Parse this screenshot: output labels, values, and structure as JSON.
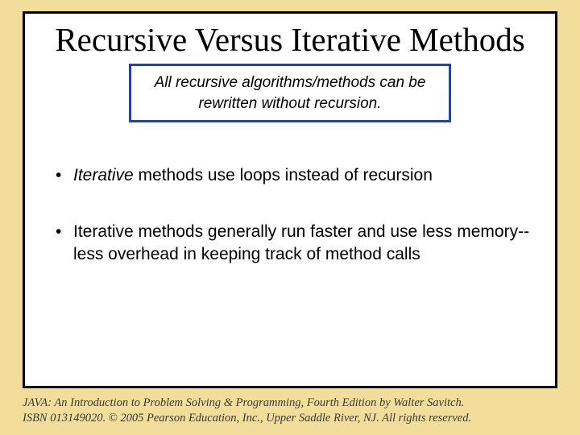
{
  "slide": {
    "title": "Recursive Versus Iterative Methods",
    "callout": "All recursive algorithms/methods can be rewritten without recursion.",
    "bullets": [
      {
        "italic": "Iterative",
        "rest": " methods use loops instead of recursion"
      },
      {
        "italic": "",
        "rest": "Iterative methods generally run faster and use less memory--less overhead in keeping track of method calls"
      }
    ]
  },
  "footer": {
    "line1": "JAVA: An Introduction to Problem Solving & Programming, Fourth Edition by Walter Savitch.",
    "line2": "ISBN 013149020. © 2005 Pearson Education, Inc., Upper Saddle River, NJ. All rights reserved."
  }
}
